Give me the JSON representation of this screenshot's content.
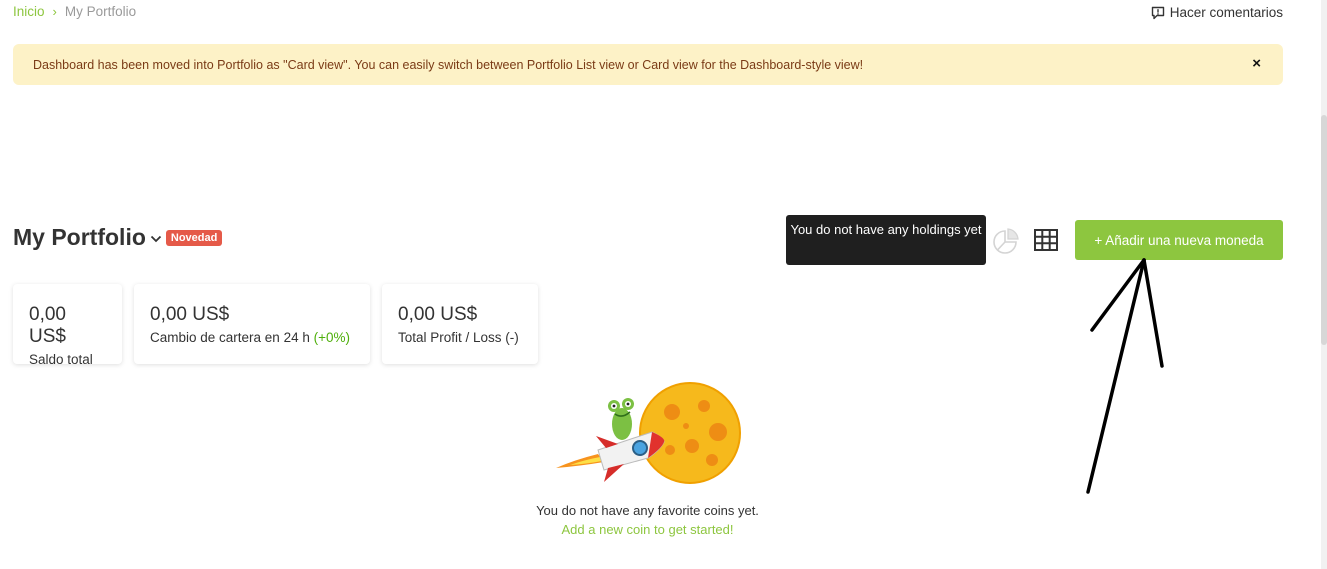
{
  "breadcrumb": {
    "home": "Inicio",
    "separator": "›",
    "current": "My Portfolio"
  },
  "feedback": {
    "label": "Hacer comentarios",
    "icon": "feedback-icon"
  },
  "banner": {
    "message": "Dashboard has been moved into Portfolio as \"Card view\". You can easily switch between Portfolio List view or Card view for the Dashboard-style view!",
    "close": "×"
  },
  "header": {
    "title": "My Portfolio",
    "badge": "Novedad"
  },
  "tooltip": {
    "text": "You do not have any holdings yet"
  },
  "toolbar": {
    "pie_icon": "pie-chart-icon",
    "grid_icon": "grid-view-icon",
    "add_button": "+ Añadir una nueva moneda"
  },
  "cards": [
    {
      "value": "0,00 US$",
      "label": "Saldo total"
    },
    {
      "value": "0,00 US$",
      "label": "Cambio de cartera en 24 h ",
      "change": "(+0%)"
    },
    {
      "value": "0,00 US$",
      "label": "Total Profit / Loss (-)"
    }
  ],
  "empty_state": {
    "message": "You do not have any favorite coins yet.",
    "link": "Add a new coin to get started!"
  },
  "colors": {
    "accent_green": "#8dc63f",
    "badge_red": "#e55a49",
    "banner_bg": "#fdf2c7",
    "banner_text": "#7a3b16",
    "tooltip_bg": "#1f1f1f"
  }
}
